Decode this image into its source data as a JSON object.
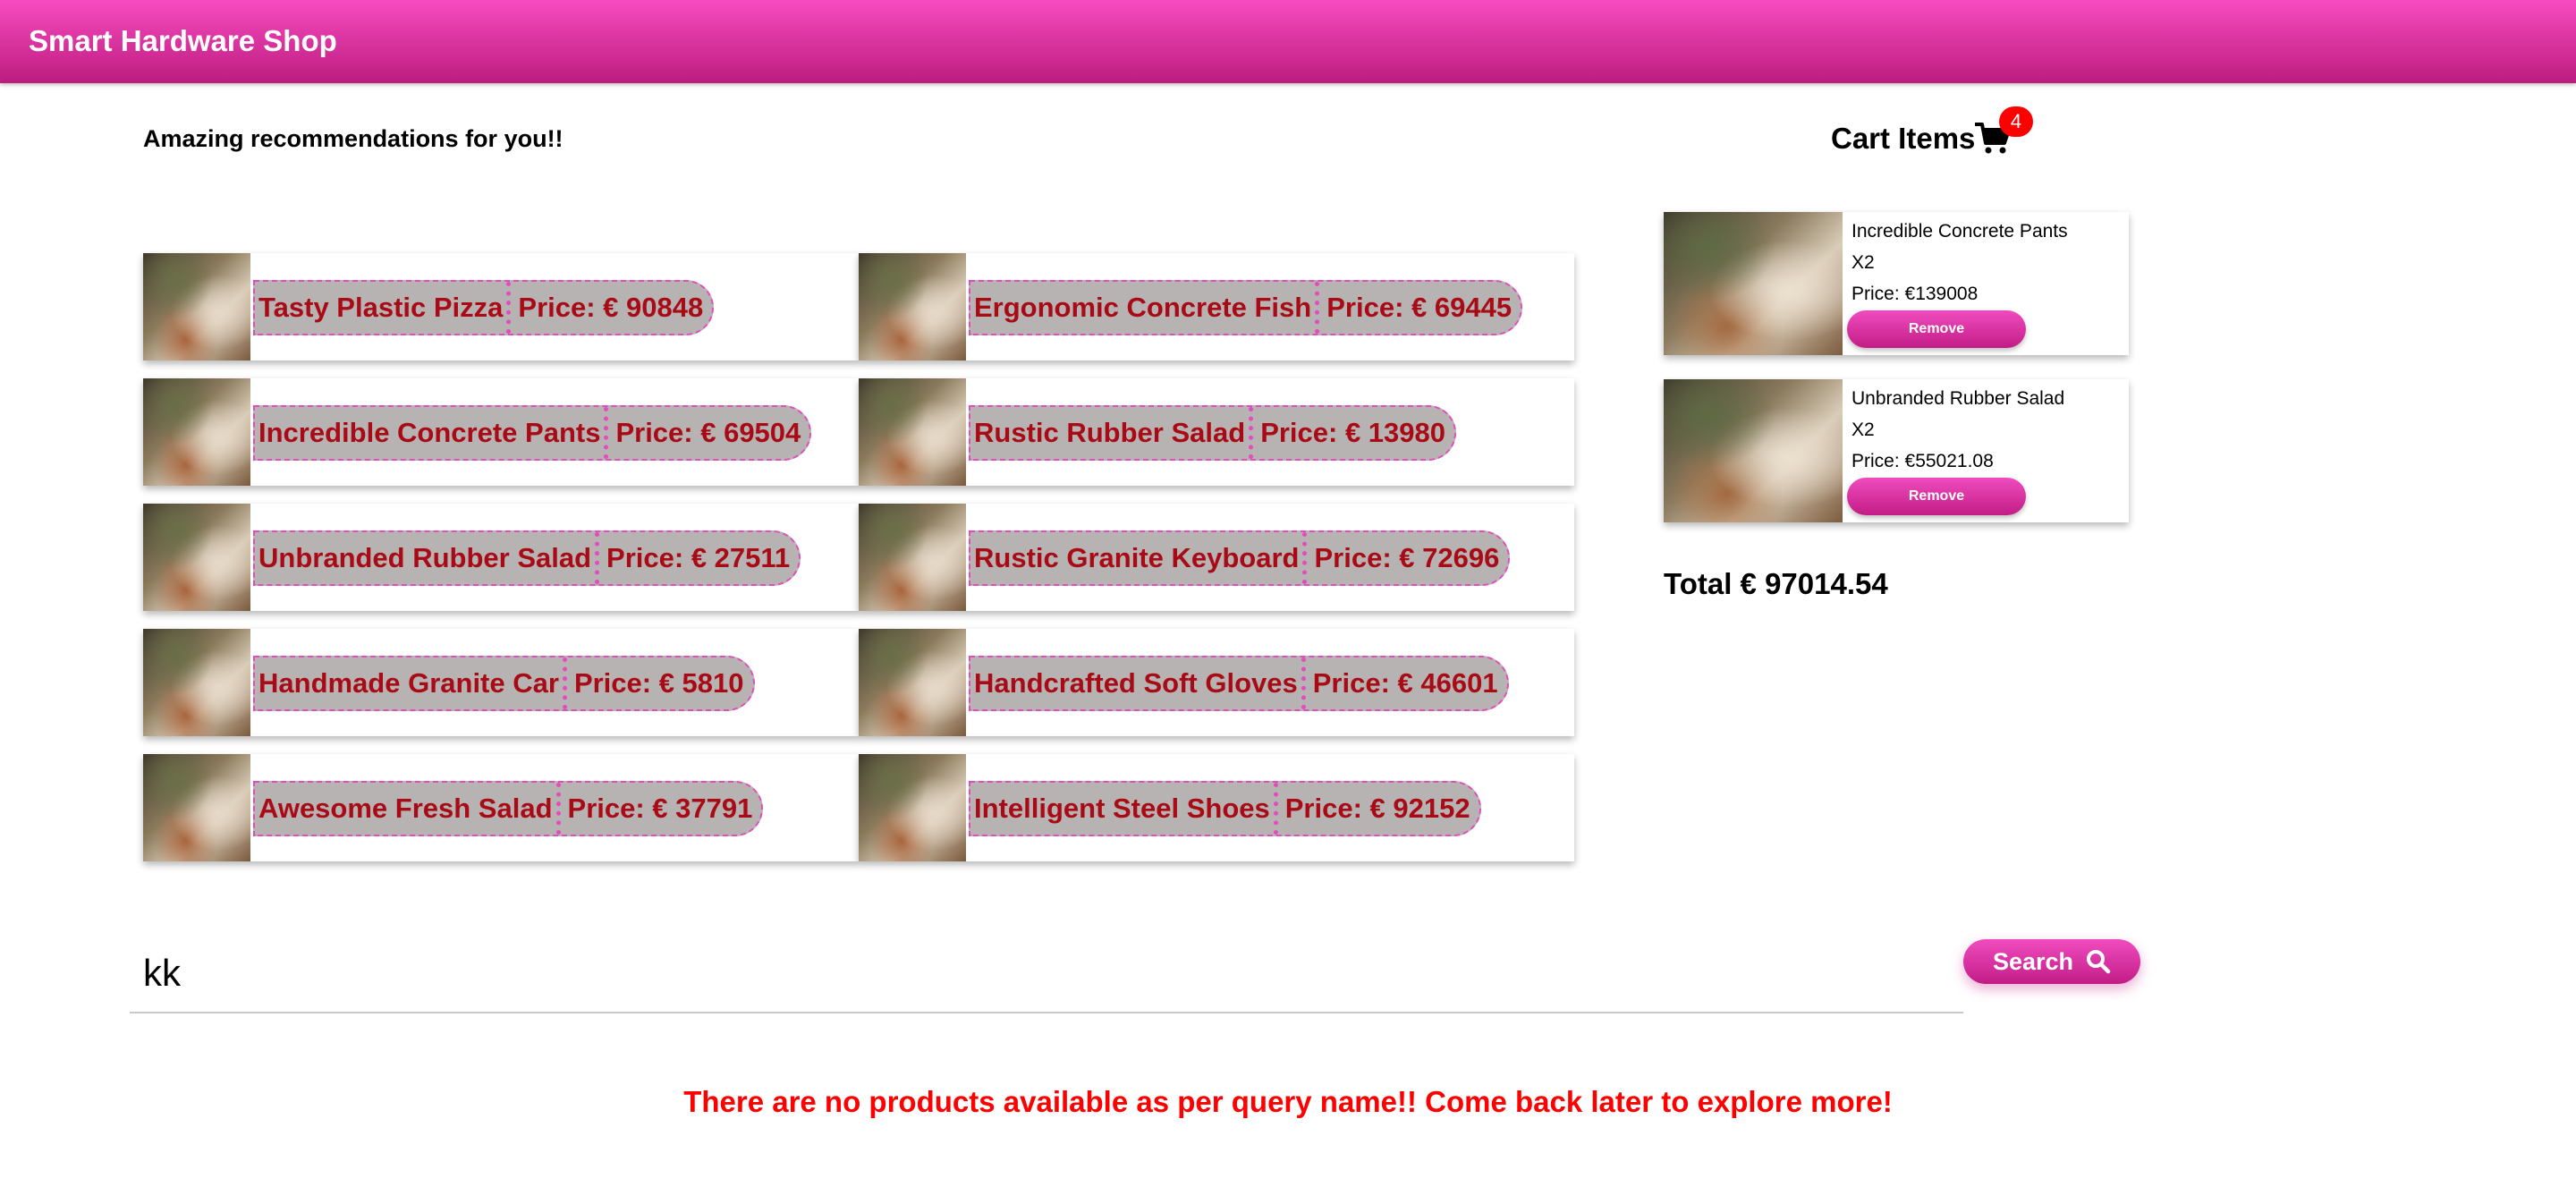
{
  "app_bar": {
    "title": "Smart Hardware Shop"
  },
  "recommendations": {
    "heading": "Amazing recommendations for you!!",
    "products": [
      {
        "name": "Tasty Plastic Pizza",
        "price": "Price: € 90848"
      },
      {
        "name": "Ergonomic Concrete Fish",
        "price": "Price: € 69445"
      },
      {
        "name": "Incredible Concrete Pants",
        "price": "Price: € 69504"
      },
      {
        "name": "Rustic Rubber Salad",
        "price": "Price: € 13980"
      },
      {
        "name": "Unbranded Rubber Salad",
        "price": "Price: € 27511"
      },
      {
        "name": "Rustic Granite Keyboard",
        "price": "Price: € 72696"
      },
      {
        "name": "Handmade Granite Car",
        "price": "Price: € 5810"
      },
      {
        "name": "Handcrafted Soft Gloves",
        "price": "Price: € 46601"
      },
      {
        "name": "Awesome Fresh Salad",
        "price": "Price: € 37791"
      },
      {
        "name": "Intelligent Steel Shoes",
        "price": "Price: € 92152"
      }
    ]
  },
  "cart": {
    "title": "Cart Items",
    "icon": "shopping-cart-icon",
    "badge_count": "4",
    "items": [
      {
        "name": "Incredible Concrete Pants",
        "qty": "X2",
        "price": "Price: €139008",
        "remove_label": "Remove"
      },
      {
        "name": "Unbranded Rubber Salad",
        "qty": "X2",
        "price": "Price: €55021.08",
        "remove_label": "Remove"
      }
    ],
    "total": "Total € 97014.54"
  },
  "search": {
    "value": "kk",
    "button_label": "Search",
    "icon": "magnifier-icon"
  },
  "messages": {
    "no_products": "There are no products available as per query name!! Come back later to explore more!"
  },
  "colors": {
    "brand_pink": "#e8389f",
    "price_text": "#a80b16",
    "alert_red": "#ff0000"
  }
}
